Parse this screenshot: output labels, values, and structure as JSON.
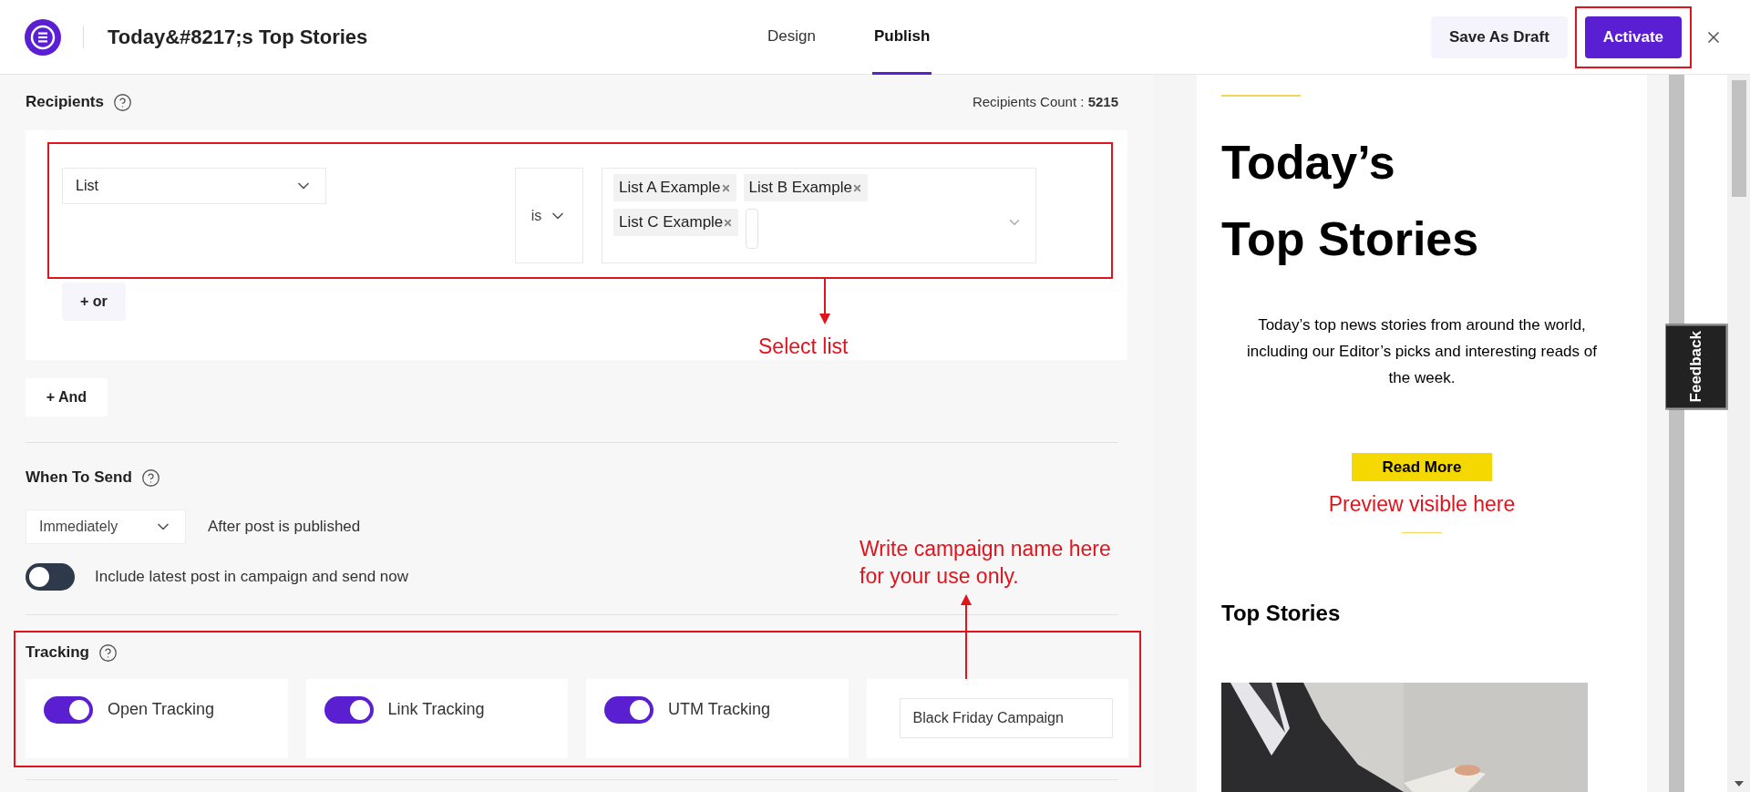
{
  "header": {
    "title": "Today&#8217;s Top Stories",
    "tabs": [
      {
        "label": "Design",
        "selected": false
      },
      {
        "label": "Publish",
        "selected": true
      }
    ],
    "buttons": [
      {
        "label": "Save As Draft",
        "kind": "secondary"
      },
      {
        "label": "Activate",
        "kind": "primary"
      }
    ]
  },
  "recipients": {
    "title": "Recipients",
    "count_label": "Recipients Count :",
    "count": "5215",
    "field": "List",
    "operator": "is",
    "tags": [
      "List A Example",
      "List B Example",
      "List C Example"
    ],
    "or_button": "+ or",
    "annotation": "Select list",
    "and_button": "+ And"
  },
  "when_to_send": {
    "title": "When To Send",
    "timing": "Immediately",
    "after": "After post is published",
    "include_latest": {
      "label": "Include latest post in campaign and send now",
      "on": false
    }
  },
  "tracking": {
    "title": "Tracking",
    "annotation": "Write campaign name here\nfor your use only.",
    "toggles": [
      {
        "label": "Open Tracking",
        "on": true
      },
      {
        "label": "Link Tracking",
        "on": true
      },
      {
        "label": "UTM Tracking",
        "on": true
      }
    ],
    "campaign_name": "Black Friday Campaign"
  },
  "preview": {
    "heading": [
      "Today’s",
      "Top Stories"
    ],
    "text": "Today’s top news stories from around the world, including our Editor’s picks and interesting reads of the week.",
    "button": "Read More",
    "annotation": "Preview visible here",
    "section_title": "Top Stories"
  },
  "feedback": "Feedback"
}
